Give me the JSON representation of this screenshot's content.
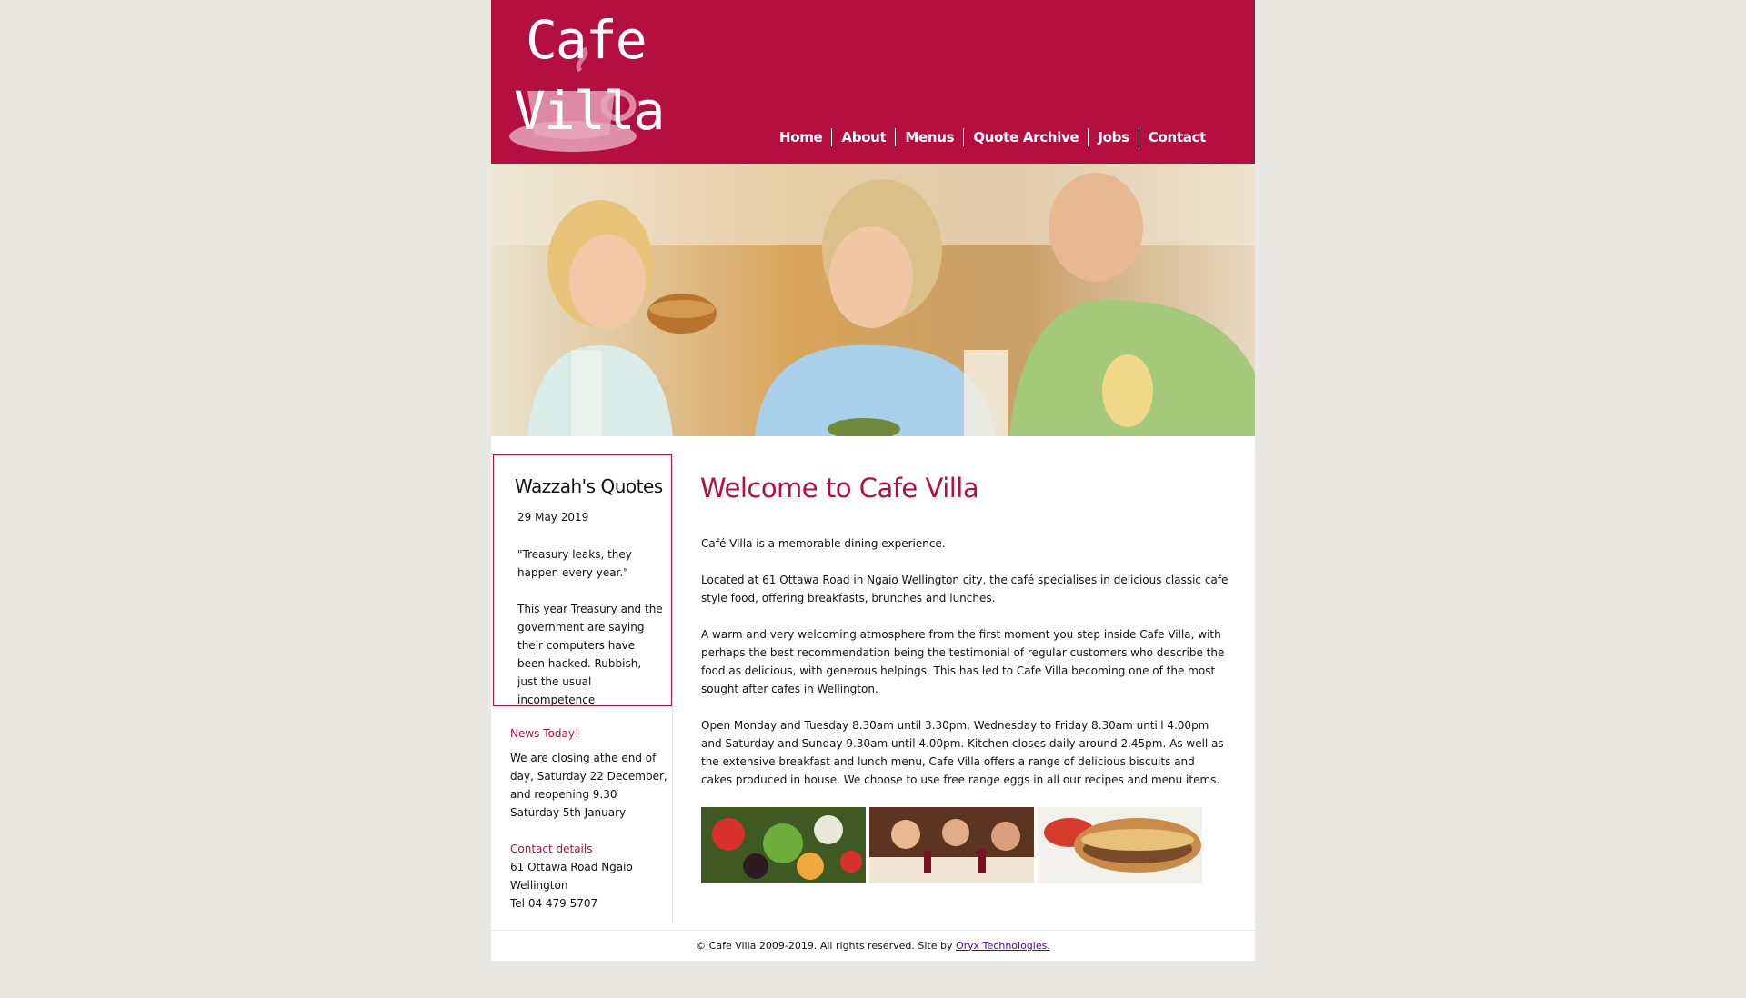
{
  "brand": {
    "logo_line1": "Cafe",
    "logo_line2": "Villa",
    "color": "#b50f42"
  },
  "nav": {
    "items": [
      {
        "label": "Home"
      },
      {
        "label": "About"
      },
      {
        "label": "Menus"
      },
      {
        "label": "Quote Archive"
      },
      {
        "label": "Jobs"
      },
      {
        "label": "Contact"
      }
    ]
  },
  "hero": {
    "icon": "family-dining-photo"
  },
  "sidebar": {
    "quote_title": "Wazzah's Quotes",
    "quote_date": "29 May 2019",
    "quote_paragraph1": "\"Treasury leaks, they happen every year.\"",
    "quote_paragraph2": "This year Treasury and the government are saying their computers have been hacked.  Rubbish, just the usual incompetence",
    "news_heading": "News Today!",
    "news_text": "We are closing athe end of day, Saturday 22 December, and reopening 9.30 Saturday 5th January",
    "contact_heading": "Contact details",
    "contact_address1": "61 Ottawa Road Ngaio",
    "contact_address2": "Wellington",
    "contact_phone": "Tel 04 479 5707"
  },
  "main": {
    "title": "Welcome to Cafe Villa",
    "paragraphs": [
      "Café Villa is a memorable dining experience.",
      "Located at 61 Ottawa Road in Ngaio Wellington city, the café specialises in delicious classic cafe style food, offering breakfasts, brunches and lunches.",
      "A warm and very welcoming atmosphere from the first moment you step inside Cafe Villa, with perhaps the best recommendation being the testimonial of regular customers who describe the food as delicious, with generous helpings.  This has led to Cafe Villa becoming one of the most sought after cafes in Wellington.",
      "Open  Monday  and Tuesday 8.30am until 3.30pm, Wednesday to Friday 8.30am untill 4.00pm and Saturday and Sunday 9.30am until 4.00pm.  Kitchen closes daily around 2.45pm.  As well as the extensive breakfast and lunch menu, Cafe Villa offers a range of delicious biscuits and cakes produced in house.  We choose to use free range eggs in all our recipes and menu items."
    ],
    "thumbnails": [
      {
        "icon": "salad-photo"
      },
      {
        "icon": "diners-photo"
      },
      {
        "icon": "sandwich-photo"
      }
    ]
  },
  "footer": {
    "text": "© Cafe Villa 2009-2019. All rights reserved. Site by ",
    "link": "Oryx Technologies."
  }
}
